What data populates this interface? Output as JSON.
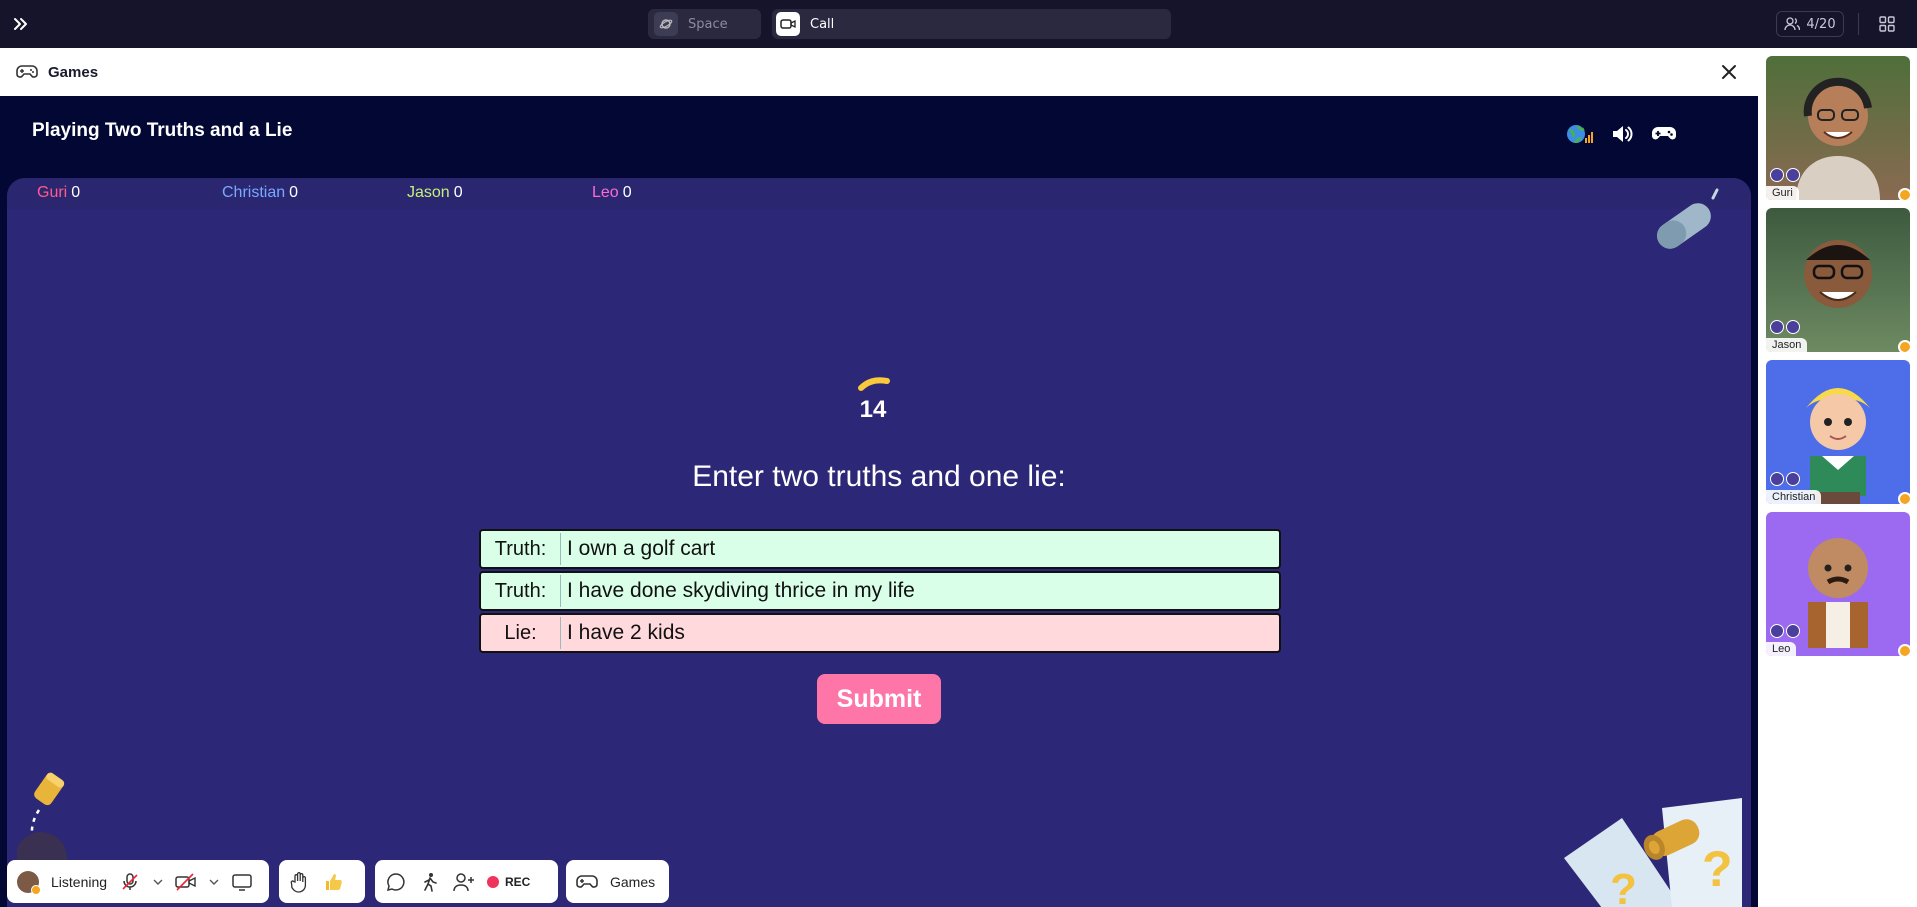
{
  "topbar": {
    "space_label": "Space",
    "call_label": "Call",
    "participants_count": "4/20"
  },
  "panel": {
    "title": "Games"
  },
  "game": {
    "title": "Playing Two Truths and a Lie",
    "scores": [
      {
        "name": "Guri",
        "score": "0",
        "color": "#ff5c8a"
      },
      {
        "name": "Christian",
        "score": "0",
        "color": "#7aa8ff"
      },
      {
        "name": "Jason",
        "score": "0",
        "color": "#c6f07a"
      },
      {
        "name": "Leo",
        "score": "0",
        "color": "#ff6ad5"
      }
    ],
    "timer": "14",
    "prompt": "Enter two truths and one lie:",
    "entries": [
      {
        "label": "Truth:",
        "value": "I own a golf cart",
        "kind": "truth"
      },
      {
        "label": "Truth:",
        "value": "I have done skydiving thrice in my life",
        "kind": "truth"
      },
      {
        "label": "Lie:",
        "value": "I have 2 kids",
        "kind": "lie"
      }
    ],
    "submit_label": "Submit"
  },
  "toolbar": {
    "status_label": "Listening",
    "rec_label": "REC",
    "games_label": "Games"
  },
  "participants": [
    {
      "name": "Guri",
      "bg": "#8a6a52"
    },
    {
      "name": "Jason",
      "bg": "#5d7a5e"
    },
    {
      "name": "Christian",
      "bg": "#4d6ee8"
    },
    {
      "name": "Leo",
      "bg": "#9b6af0"
    }
  ],
  "colors": {
    "accent_submit": "#fe75a8",
    "board": "#2c2776",
    "header_dark": "#020733",
    "truth_bg": "#d9ffe8",
    "lie_bg": "#ffd9dc"
  }
}
